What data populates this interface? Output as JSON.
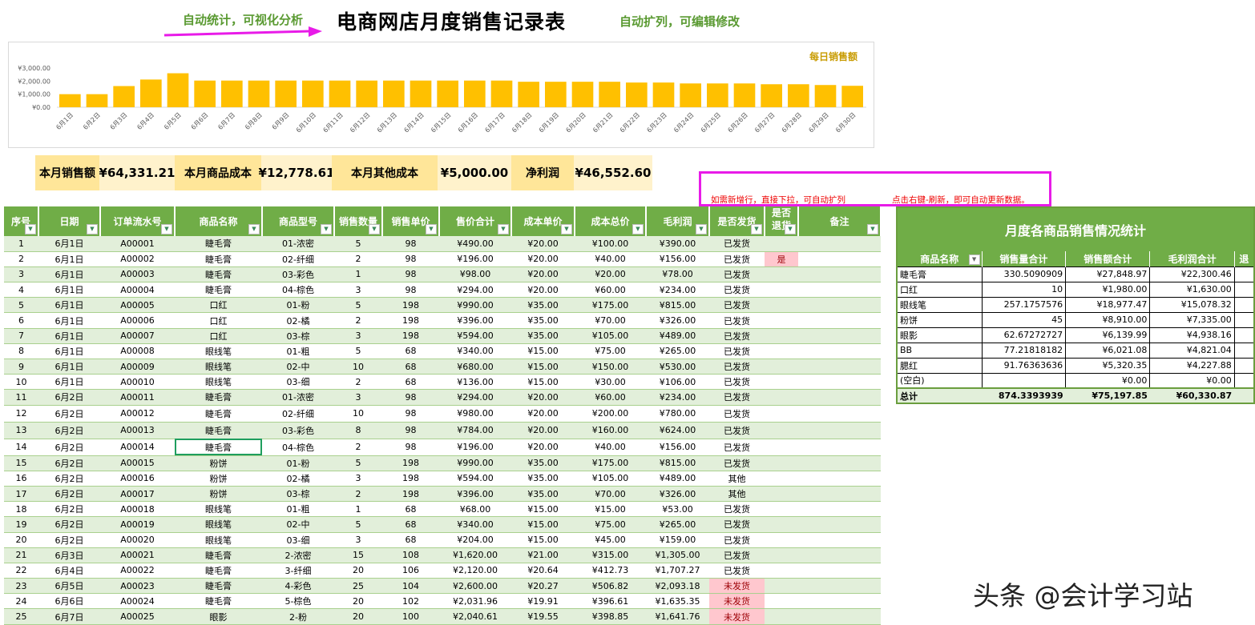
{
  "header": {
    "title": "电商网店月度销售记录表",
    "note_left": "自动统计，可视化分析",
    "note_right": "自动扩列，可编辑修改"
  },
  "colors": {
    "bar": "#ffc000",
    "header_green": "#70ad47",
    "row_band": "#e2efda",
    "arrow": "#e81be8"
  },
  "chart_data": {
    "type": "bar",
    "title": "每日销售额",
    "xlabel": "",
    "ylabel": "",
    "ylim": [
      0,
      3000
    ],
    "yticks": [
      "¥0.00",
      "¥1,000.00",
      "¥2,000.00",
      "¥3,000.00"
    ],
    "categories": [
      "6月1日",
      "6月2日",
      "6月3日",
      "6月4日",
      "6月5日",
      "6月6日",
      "6月7日",
      "6月8日",
      "6月9日",
      "6月10日",
      "6月11日",
      "6月12日",
      "6月13日",
      "6月14日",
      "6月15日",
      "6月16日",
      "6月17日",
      "6月18日",
      "6月19日",
      "6月20日",
      "6月21日",
      "6月22日",
      "6月23日",
      "6月24日",
      "6月25日",
      "6月26日",
      "6月27日",
      "6月28日",
      "6月29日",
      "6月30日"
    ],
    "values": [
      1000,
      1000,
      1620,
      2120,
      2600,
      2040,
      2040,
      2040,
      2040,
      2040,
      2040,
      2040,
      2040,
      2040,
      2040,
      2040,
      2040,
      1950,
      1950,
      1950,
      1950,
      1890,
      1890,
      1820,
      1820,
      1820,
      1760,
      1760,
      1700,
      1640
    ]
  },
  "kpis": [
    {
      "label": "本月销售额",
      "value": "¥64,331.21"
    },
    {
      "label": "本月商品成本",
      "value": "¥12,778.61"
    },
    {
      "label": "本月其他成本",
      "value": "¥5,000.00"
    },
    {
      "label": "净利润",
      "value": "¥46,552.60"
    }
  ],
  "tips": {
    "left": "如需新增行，直接下拉，可自动扩列",
    "right": "点击右键-刷新，即可自动更新数据。"
  },
  "table": {
    "columns": [
      "序号",
      "日期",
      "订单流水号",
      "商品名称",
      "商品型号",
      "销售数量",
      "销售单价",
      "售价合计",
      "成本单价",
      "成本总价",
      "毛利润",
      "是否发货",
      "是否退货",
      "备注"
    ],
    "rows": [
      [
        "1",
        "6月1日",
        "A00001",
        "睫毛膏",
        "01-浓密",
        "5",
        "98",
        "¥490.00",
        "¥20.00",
        "¥100.00",
        "¥390.00",
        "已发货",
        "",
        ""
      ],
      [
        "2",
        "6月1日",
        "A00002",
        "睫毛膏",
        "02-纤细",
        "2",
        "98",
        "¥196.00",
        "¥20.00",
        "¥40.00",
        "¥156.00",
        "已发货",
        "是",
        ""
      ],
      [
        "3",
        "6月1日",
        "A00003",
        "睫毛膏",
        "03-彩色",
        "1",
        "98",
        "¥98.00",
        "¥20.00",
        "¥20.00",
        "¥78.00",
        "已发货",
        "",
        ""
      ],
      [
        "4",
        "6月1日",
        "A00004",
        "睫毛膏",
        "04-棕色",
        "3",
        "98",
        "¥294.00",
        "¥20.00",
        "¥60.00",
        "¥234.00",
        "已发货",
        "",
        ""
      ],
      [
        "5",
        "6月1日",
        "A00005",
        "口红",
        "01-粉",
        "5",
        "198",
        "¥990.00",
        "¥35.00",
        "¥175.00",
        "¥815.00",
        "已发货",
        "",
        ""
      ],
      [
        "6",
        "6月1日",
        "A00006",
        "口红",
        "02-橘",
        "2",
        "198",
        "¥396.00",
        "¥35.00",
        "¥70.00",
        "¥326.00",
        "已发货",
        "",
        ""
      ],
      [
        "7",
        "6月1日",
        "A00007",
        "口红",
        "03-棕",
        "3",
        "198",
        "¥594.00",
        "¥35.00",
        "¥105.00",
        "¥489.00",
        "已发货",
        "",
        ""
      ],
      [
        "8",
        "6月1日",
        "A00008",
        "眼线笔",
        "01-粗",
        "5",
        "68",
        "¥340.00",
        "¥15.00",
        "¥75.00",
        "¥265.00",
        "已发货",
        "",
        ""
      ],
      [
        "9",
        "6月1日",
        "A00009",
        "眼线笔",
        "02-中",
        "10",
        "68",
        "¥680.00",
        "¥15.00",
        "¥150.00",
        "¥530.00",
        "已发货",
        "",
        ""
      ],
      [
        "10",
        "6月1日",
        "A00010",
        "眼线笔",
        "03-细",
        "2",
        "68",
        "¥136.00",
        "¥15.00",
        "¥30.00",
        "¥106.00",
        "已发货",
        "",
        ""
      ],
      [
        "11",
        "6月2日",
        "A00011",
        "睫毛膏",
        "01-浓密",
        "3",
        "98",
        "¥294.00",
        "¥20.00",
        "¥60.00",
        "¥234.00",
        "已发货",
        "",
        ""
      ],
      [
        "12",
        "6月2日",
        "A00012",
        "睫毛膏",
        "02-纤细",
        "10",
        "98",
        "¥980.00",
        "¥20.00",
        "¥200.00",
        "¥780.00",
        "已发货",
        "",
        ""
      ],
      [
        "13",
        "6月2日",
        "A00013",
        "睫毛膏",
        "03-彩色",
        "8",
        "98",
        "¥784.00",
        "¥20.00",
        "¥160.00",
        "¥624.00",
        "已发货",
        "",
        ""
      ],
      [
        "14",
        "6月2日",
        "A00014",
        "睫毛膏",
        "04-棕色",
        "2",
        "98",
        "¥196.00",
        "¥20.00",
        "¥40.00",
        "¥156.00",
        "已发货",
        "",
        ""
      ],
      [
        "15",
        "6月2日",
        "A00015",
        "粉饼",
        "01-粉",
        "5",
        "198",
        "¥990.00",
        "¥35.00",
        "¥175.00",
        "¥815.00",
        "已发货",
        "",
        ""
      ],
      [
        "16",
        "6月2日",
        "A00016",
        "粉饼",
        "02-橘",
        "3",
        "198",
        "¥594.00",
        "¥35.00",
        "¥105.00",
        "¥489.00",
        "其他",
        "",
        ""
      ],
      [
        "17",
        "6月2日",
        "A00017",
        "粉饼",
        "03-棕",
        "2",
        "198",
        "¥396.00",
        "¥35.00",
        "¥70.00",
        "¥326.00",
        "其他",
        "",
        ""
      ],
      [
        "18",
        "6月2日",
        "A00018",
        "眼线笔",
        "01-粗",
        "1",
        "68",
        "¥68.00",
        "¥15.00",
        "¥15.00",
        "¥53.00",
        "已发货",
        "",
        ""
      ],
      [
        "19",
        "6月2日",
        "A00019",
        "眼线笔",
        "02-中",
        "5",
        "68",
        "¥340.00",
        "¥15.00",
        "¥75.00",
        "¥265.00",
        "已发货",
        "",
        ""
      ],
      [
        "20",
        "6月2日",
        "A00020",
        "眼线笔",
        "03-细",
        "3",
        "68",
        "¥204.00",
        "¥15.00",
        "¥45.00",
        "¥159.00",
        "已发货",
        "",
        ""
      ],
      [
        "21",
        "6月3日",
        "A00021",
        "睫毛膏",
        "2-浓密",
        "15",
        "108",
        "¥1,620.00",
        "¥21.00",
        "¥315.00",
        "¥1,305.00",
        "已发货",
        "",
        ""
      ],
      [
        "22",
        "6月4日",
        "A00022",
        "睫毛膏",
        "3-纤细",
        "20",
        "106",
        "¥2,120.00",
        "¥20.64",
        "¥412.73",
        "¥1,707.27",
        "已发货",
        "",
        ""
      ],
      [
        "23",
        "6月5日",
        "A00023",
        "睫毛膏",
        "4-彩色",
        "25",
        "104",
        "¥2,600.00",
        "¥20.27",
        "¥506.82",
        "¥2,093.18",
        "未发货",
        "",
        ""
      ],
      [
        "24",
        "6月6日",
        "A00024",
        "睫毛膏",
        "5-棕色",
        "20",
        "102",
        "¥2,031.96",
        "¥19.91",
        "¥396.61",
        "¥1,635.35",
        "未发货",
        "",
        ""
      ],
      [
        "25",
        "6月7日",
        "A00025",
        "眼影",
        "2-粉",
        "20",
        "100",
        "¥2,040.61",
        "¥19.55",
        "¥398.85",
        "¥1,641.76",
        "未发货",
        "",
        ""
      ]
    ]
  },
  "pivot": {
    "title": "月度各商品销售情况统计",
    "columns": [
      "商品名称",
      "销售量合计",
      "销售额合计",
      "毛利润合计",
      "退"
    ],
    "rows": [
      [
        "睫毛膏",
        "330.5090909",
        "¥27,848.97",
        "¥22,300.46"
      ],
      [
        "口红",
        "10",
        "¥1,980.00",
        "¥1,630.00"
      ],
      [
        "眼线笔",
        "257.1757576",
        "¥18,977.47",
        "¥15,078.32"
      ],
      [
        "粉饼",
        "45",
        "¥8,910.00",
        "¥7,335.00"
      ],
      [
        "眼影",
        "62.67272727",
        "¥6,139.99",
        "¥4,938.16"
      ],
      [
        "BB",
        "77.21818182",
        "¥6,021.08",
        "¥4,821.04"
      ],
      [
        "腮红",
        "91.76363636",
        "¥5,320.35",
        "¥4,227.88"
      ],
      [
        "(空白)",
        "",
        "¥0.00",
        "¥0.00"
      ]
    ],
    "total": [
      "总计",
      "874.3393939",
      "¥75,197.85",
      "¥60,330.87"
    ]
  },
  "watermark": "头条 @会计学习站"
}
